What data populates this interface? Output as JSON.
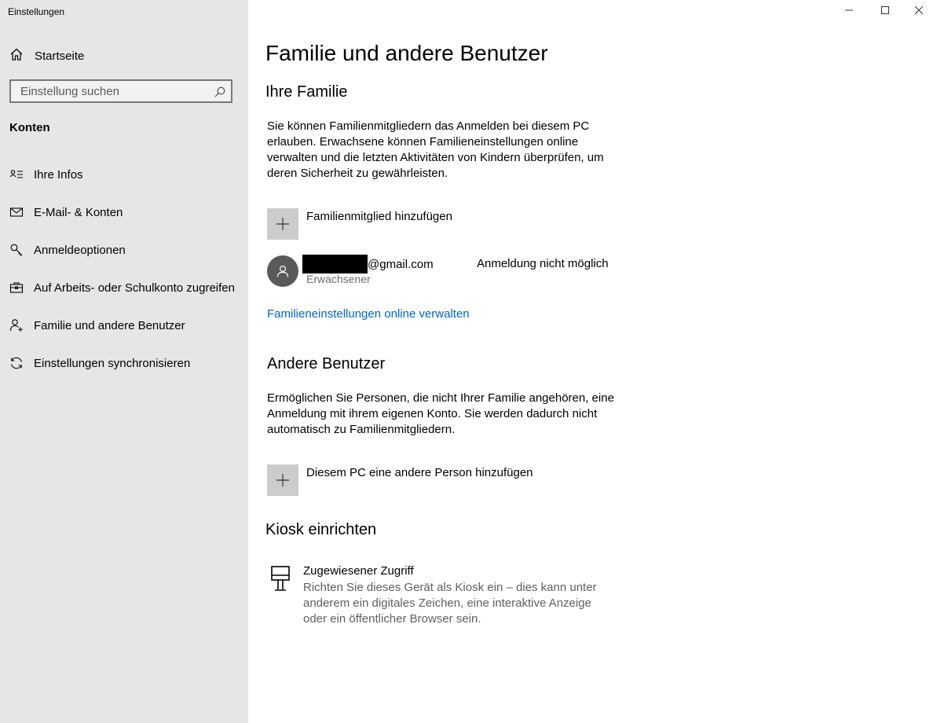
{
  "window": {
    "title": "Einstellungen",
    "controls": {
      "minimize": "minimize-icon",
      "maximize": "maximize-icon",
      "close": "close-icon"
    }
  },
  "sidebar": {
    "home_label": "Startseite",
    "search_placeholder": "Einstellung suchen",
    "section": "Konten",
    "items": [
      {
        "label": "Ihre Infos",
        "icon": "contact-card-icon"
      },
      {
        "label": "E-Mail- & Konten",
        "icon": "mail-icon"
      },
      {
        "label": "Anmeldeoptionen",
        "icon": "key-icon"
      },
      {
        "label": "Auf Arbeits- oder Schulkonto zugreifen",
        "icon": "briefcase-icon"
      },
      {
        "label": "Familie und andere Benutzer",
        "icon": "person-add-icon"
      },
      {
        "label": "Einstellungen synchronisieren",
        "icon": "sync-icon"
      }
    ]
  },
  "main": {
    "title": "Familie und andere Benutzer",
    "family": {
      "heading": "Ihre Familie",
      "description": "Sie können Familienmitgliedern das Anmelden bei diesem PC erlauben. Erwachsene können Familieneinstellungen online verwalten und die letzten Aktivitäten von Kindern überprüfen, um deren Sicherheit zu gewährleisten.",
      "add_label": "Familienmitglied hinzufügen",
      "member": {
        "email_suffix": "@gmail.com",
        "role": "Erwachsener",
        "status": "Anmeldung nicht möglich"
      },
      "manage_link": "Familieneinstellungen online verwalten"
    },
    "others": {
      "heading": "Andere Benutzer",
      "description": "Ermöglichen Sie Personen, die nicht Ihrer Familie angehören, eine Anmeldung mit ihrem eigenen Konto. Sie werden dadurch nicht automatisch zu Familienmitgliedern.",
      "add_label": "Diesem PC eine andere Person hinzufügen"
    },
    "kiosk": {
      "heading": "Kiosk einrichten",
      "title": "Zugewiesener Zugriff",
      "description": "Richten Sie dieses Gerät als Kiosk ein – dies kann unter anderem ein digitales Zeichen, eine interaktive Anzeige oder ein öffentlicher Browser sein."
    }
  }
}
